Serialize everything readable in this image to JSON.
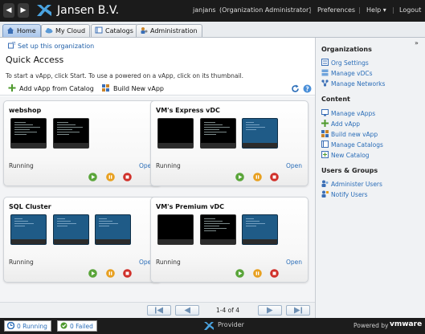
{
  "topbar": {
    "org_name": "Jansen B.V.",
    "user": "janjans",
    "role": "(Organization Administrator)",
    "preferences": "Preferences",
    "help": "Help",
    "help_caret": "▾",
    "logout": "Logout",
    "back_glyph": "◀",
    "forward_glyph": "▶",
    "separator": "|"
  },
  "tabs": [
    {
      "label": "Home",
      "icon": "home-icon",
      "active": true
    },
    {
      "label": "My Cloud",
      "icon": "cloud-icon",
      "active": false
    },
    {
      "label": "Catalogs",
      "icon": "catalog-icon",
      "active": false
    },
    {
      "label": "Administration",
      "icon": "admin-icon",
      "active": false
    }
  ],
  "main": {
    "setup_link": "Set up this organization",
    "title": "Quick Access",
    "description": "To start a vApp, click Start. To use a powered on a vApp, click on its thumbnail.",
    "actions": {
      "add_from_catalog": "Add vApp from Catalog",
      "build_new": "Build New vApp"
    },
    "cards": [
      {
        "name": "webshop",
        "status": "Running",
        "open": "Open",
        "thumbs": [
          "console",
          "console"
        ]
      },
      {
        "name": "VM's Express vDC",
        "status": "Running",
        "open": "Open",
        "thumbs": [
          "dark",
          "console",
          "blue"
        ]
      },
      {
        "name": "SQL Cluster",
        "status": "Running",
        "open": "Open",
        "thumbs": [
          "blue",
          "blue",
          "blue"
        ]
      },
      {
        "name": "VM's Premium vDC",
        "status": "Running",
        "open": "Open",
        "thumbs": [
          "dark",
          "console",
          "blue"
        ]
      }
    ],
    "pager": {
      "info": "1-4 of 4"
    }
  },
  "sidebar": {
    "collapse": "»",
    "organizations": {
      "heading": "Organizations",
      "items": [
        "Org Settings",
        "Manage vDCs",
        "Manage Networks"
      ]
    },
    "content": {
      "heading": "Content",
      "items": [
        "Manage vApps",
        "Add vApp",
        "Build new vApp",
        "Manage Catalogs",
        "New Catalog"
      ]
    },
    "users_groups": {
      "heading": "Users & Groups",
      "items": [
        "Administer Users",
        "Notify Users"
      ]
    }
  },
  "bottombar": {
    "running": "0 Running",
    "failed": "0 Failed",
    "provider": "Provider",
    "powered_by": "Powered by",
    "vmware": "vmware"
  },
  "colors": {
    "link": "#2a6db8",
    "start": "#5aa53a",
    "pause": "#e8a020",
    "stop": "#d0302a"
  }
}
